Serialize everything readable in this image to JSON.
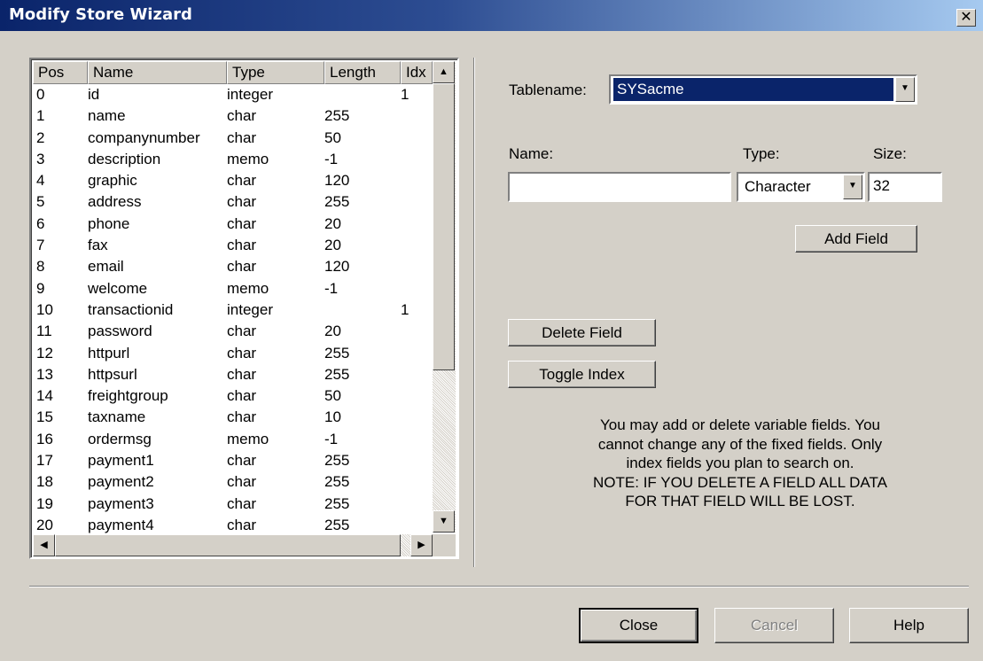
{
  "window": {
    "title": "Modify Store Wizard",
    "close_glyph": "✕"
  },
  "list": {
    "columns": [
      "Pos",
      "Name",
      "Type",
      "Length",
      "Idx"
    ],
    "rows": [
      [
        "0",
        "id",
        "integer",
        "",
        "1"
      ],
      [
        "1",
        "name",
        "char",
        "255",
        ""
      ],
      [
        "2",
        "companynumber",
        "char",
        "50",
        ""
      ],
      [
        "3",
        "description",
        "memo",
        "-1",
        ""
      ],
      [
        "4",
        "graphic",
        "char",
        "120",
        ""
      ],
      [
        "5",
        "address",
        "char",
        "255",
        ""
      ],
      [
        "6",
        "phone",
        "char",
        "20",
        ""
      ],
      [
        "7",
        "fax",
        "char",
        "20",
        ""
      ],
      [
        "8",
        "email",
        "char",
        "120",
        ""
      ],
      [
        "9",
        "welcome",
        "memo",
        "-1",
        ""
      ],
      [
        "10",
        "transactionid",
        "integer",
        "",
        "1"
      ],
      [
        "11",
        "password",
        "char",
        "20",
        ""
      ],
      [
        "12",
        "httpurl",
        "char",
        "255",
        ""
      ],
      [
        "13",
        "httpsurl",
        "char",
        "255",
        ""
      ],
      [
        "14",
        "freightgroup",
        "char",
        "50",
        ""
      ],
      [
        "15",
        "taxname",
        "char",
        "10",
        ""
      ],
      [
        "16",
        "ordermsg",
        "memo",
        "-1",
        ""
      ],
      [
        "17",
        "payment1",
        "char",
        "255",
        ""
      ],
      [
        "18",
        "payment2",
        "char",
        "255",
        ""
      ],
      [
        "19",
        "payment3",
        "char",
        "255",
        ""
      ],
      [
        "20",
        "payment4",
        "char",
        "255",
        ""
      ]
    ]
  },
  "form": {
    "tablename_label": "Tablename:",
    "tablename_value": "SYSacme",
    "name_label": "Name:",
    "name_value": "",
    "type_label": "Type:",
    "type_value": "Character",
    "size_label": "Size:",
    "size_value": "32",
    "add_field": "Add Field",
    "delete_field": "Delete Field",
    "toggle_index": "Toggle Index",
    "note": "You may add or delete variable fields. You\ncannot change any of the fixed fields. Only\nindex fields you plan to search on.\nNOTE: IF YOU DELETE A FIELD ALL DATA\nFOR THAT FIELD WILL BE LOST."
  },
  "footer": {
    "close": "Close",
    "cancel": "Cancel",
    "help": "Help"
  },
  "icons": {
    "dropdown": "down-arrow-icon",
    "scroll_up": "up-arrow-icon",
    "scroll_down": "down-arrow-icon",
    "scroll_left": "left-arrow-icon",
    "scroll_right": "right-arrow-icon"
  }
}
